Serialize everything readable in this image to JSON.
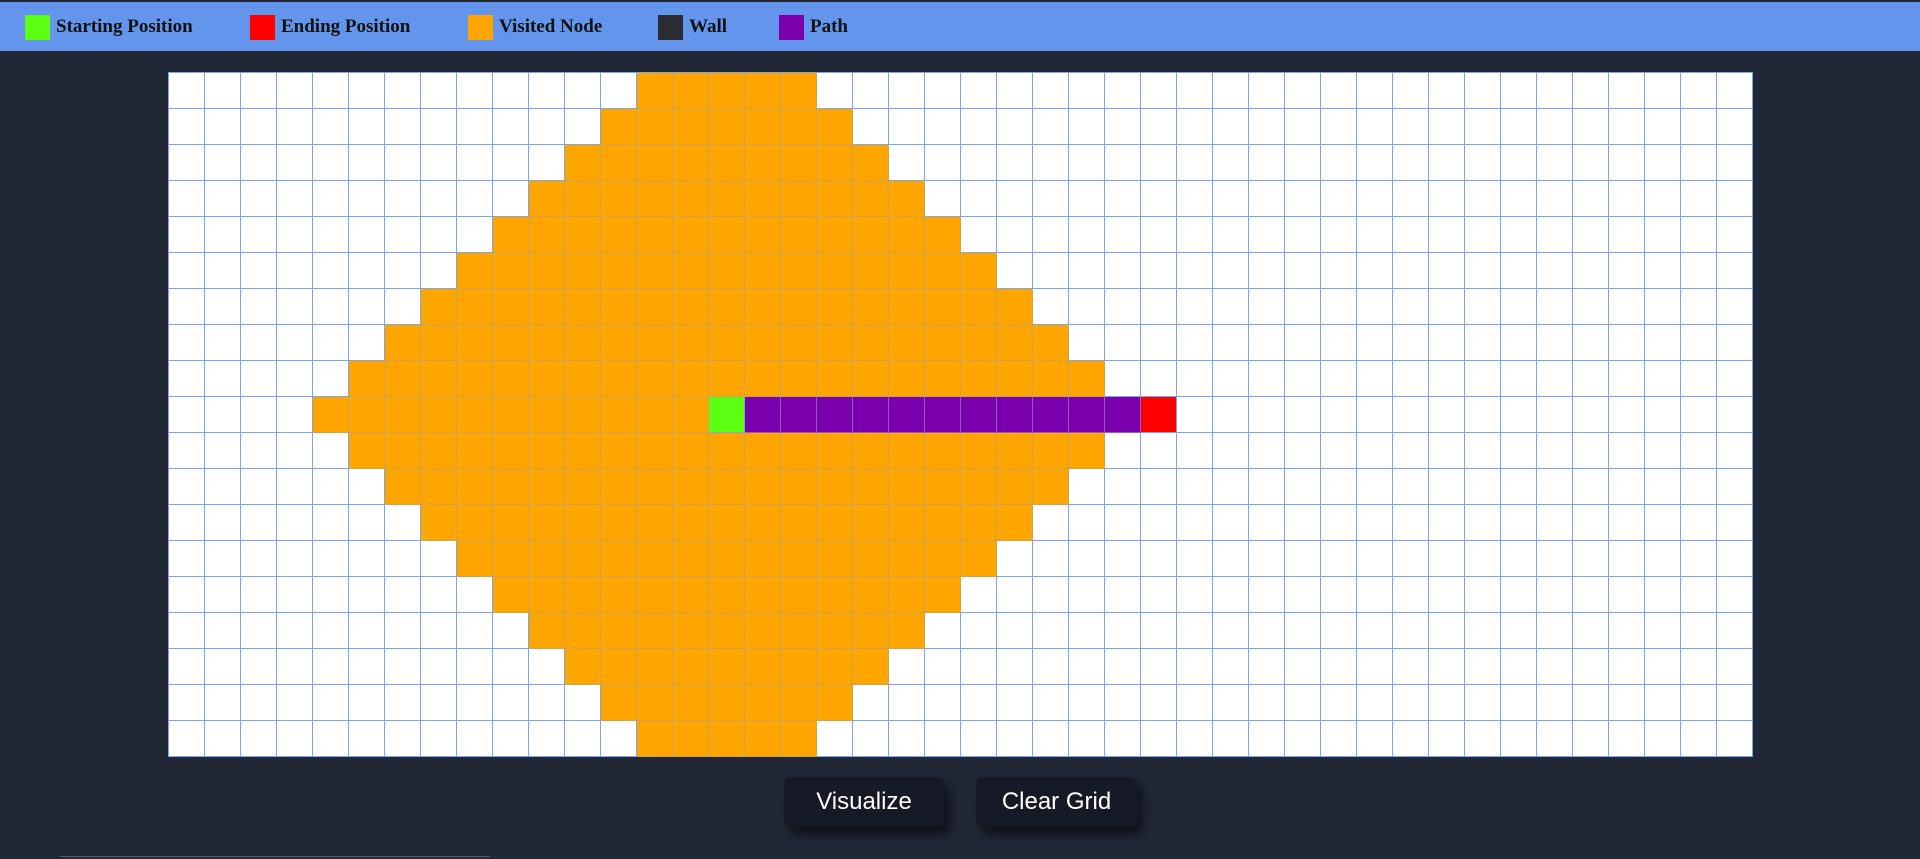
{
  "legend": [
    {
      "label": "Starting Position",
      "color": "#5cff12",
      "name": "legend-start"
    },
    {
      "label": "Ending Position",
      "color": "#ff0000",
      "name": "legend-end"
    },
    {
      "label": "Visited Node",
      "color": "#ffa500",
      "name": "legend-visited"
    },
    {
      "label": "Wall",
      "color": "#2b2b33",
      "name": "legend-wall"
    },
    {
      "label": "Path",
      "color": "#7b00ad",
      "name": "legend-path"
    }
  ],
  "grid": {
    "rows": 19,
    "cols": 44,
    "start": [
      9,
      15
    ],
    "end": [
      9,
      27
    ],
    "visited_center": [
      9,
      15
    ],
    "visited_radius": 11,
    "path_cells": [
      [
        9,
        16
      ],
      [
        9,
        17
      ],
      [
        9,
        18
      ],
      [
        9,
        19
      ],
      [
        9,
        20
      ],
      [
        9,
        21
      ],
      [
        9,
        22
      ],
      [
        9,
        23
      ],
      [
        9,
        24
      ],
      [
        9,
        25
      ],
      [
        9,
        26
      ]
    ],
    "walls": []
  },
  "buttons": {
    "visualize": "Visualize",
    "clear": "Clear Grid"
  }
}
